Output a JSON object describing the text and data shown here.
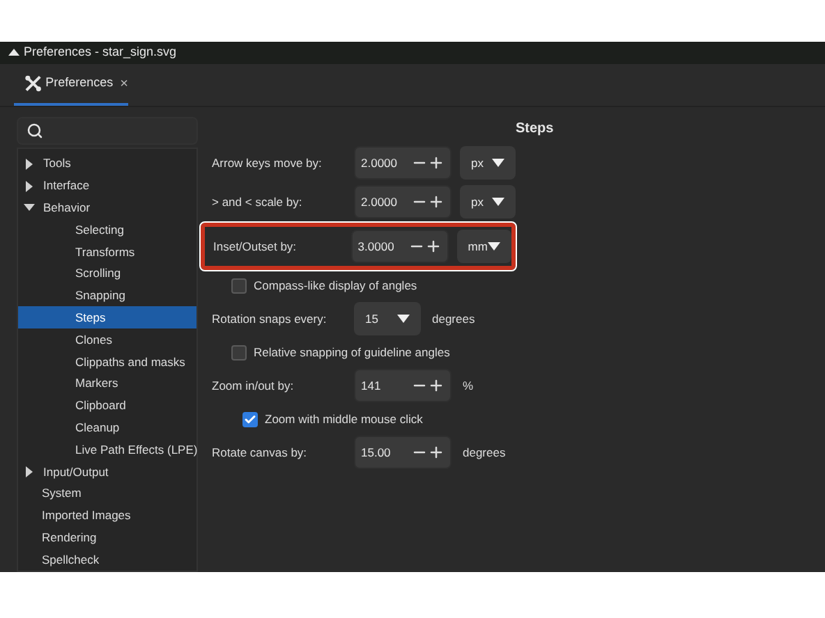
{
  "window": {
    "title": "Preferences - star_sign.svg"
  },
  "tabs": [
    {
      "label": "Preferences",
      "close": "×",
      "selected": true
    }
  ],
  "sidebar": {
    "items": [
      {
        "label": "Tools",
        "expanded": false,
        "selected": false
      },
      {
        "label": "Interface",
        "expanded": false,
        "selected": false
      },
      {
        "label": "Behavior",
        "expanded": true,
        "selected": false,
        "children": [
          {
            "label": "Selecting",
            "selected": false
          },
          {
            "label": "Transforms",
            "selected": false
          },
          {
            "label": "Scrolling",
            "selected": false
          },
          {
            "label": "Snapping",
            "selected": false
          },
          {
            "label": "Steps",
            "selected": true
          },
          {
            "label": "Clones",
            "selected": false
          },
          {
            "label": "Clippaths and masks",
            "selected": false
          },
          {
            "label": "Markers",
            "selected": false
          },
          {
            "label": "Clipboard",
            "selected": false
          },
          {
            "label": "Cleanup",
            "selected": false
          },
          {
            "label": "Live Path Effects (LPE)",
            "selected": false
          }
        ]
      },
      {
        "label": "Input/Output",
        "expanded": false,
        "selected": false
      },
      {
        "label": "System",
        "selected": false
      },
      {
        "label": "Imported Images",
        "selected": false
      },
      {
        "label": "Rendering",
        "selected": false
      },
      {
        "label": "Spellcheck",
        "selected": false
      }
    ]
  },
  "page": {
    "title": "Steps",
    "rows": [
      {
        "kind": "spin",
        "label": "Arrow keys move by:",
        "value": "2.0000",
        "unit_menu": "px",
        "highlighted": false
      },
      {
        "kind": "spin",
        "label": "> and < scale by:",
        "value": "2.0000",
        "unit_menu": "px",
        "highlighted": false
      },
      {
        "kind": "spin",
        "label": "Inset/Outset by:",
        "value": "3.0000",
        "unit_menu": "mm",
        "highlighted": true
      },
      {
        "kind": "checkbox",
        "label": "Compass-like display of angles",
        "checked": false
      },
      {
        "kind": "dropdown",
        "label": "Rotation snaps every:",
        "value": "15",
        "unit": "degrees"
      },
      {
        "kind": "checkbox",
        "label": "Relative snapping of guideline angles",
        "checked": false
      },
      {
        "kind": "spin",
        "label": "Zoom in/out by:",
        "value": "141",
        "unit": "%",
        "highlighted": false
      },
      {
        "kind": "checkbox",
        "label": "Zoom with middle mouse click",
        "checked": true,
        "indented": true
      },
      {
        "kind": "spin",
        "label": "Rotate canvas by:",
        "value": "15.00",
        "unit": "degrees",
        "highlighted": false
      }
    ]
  }
}
